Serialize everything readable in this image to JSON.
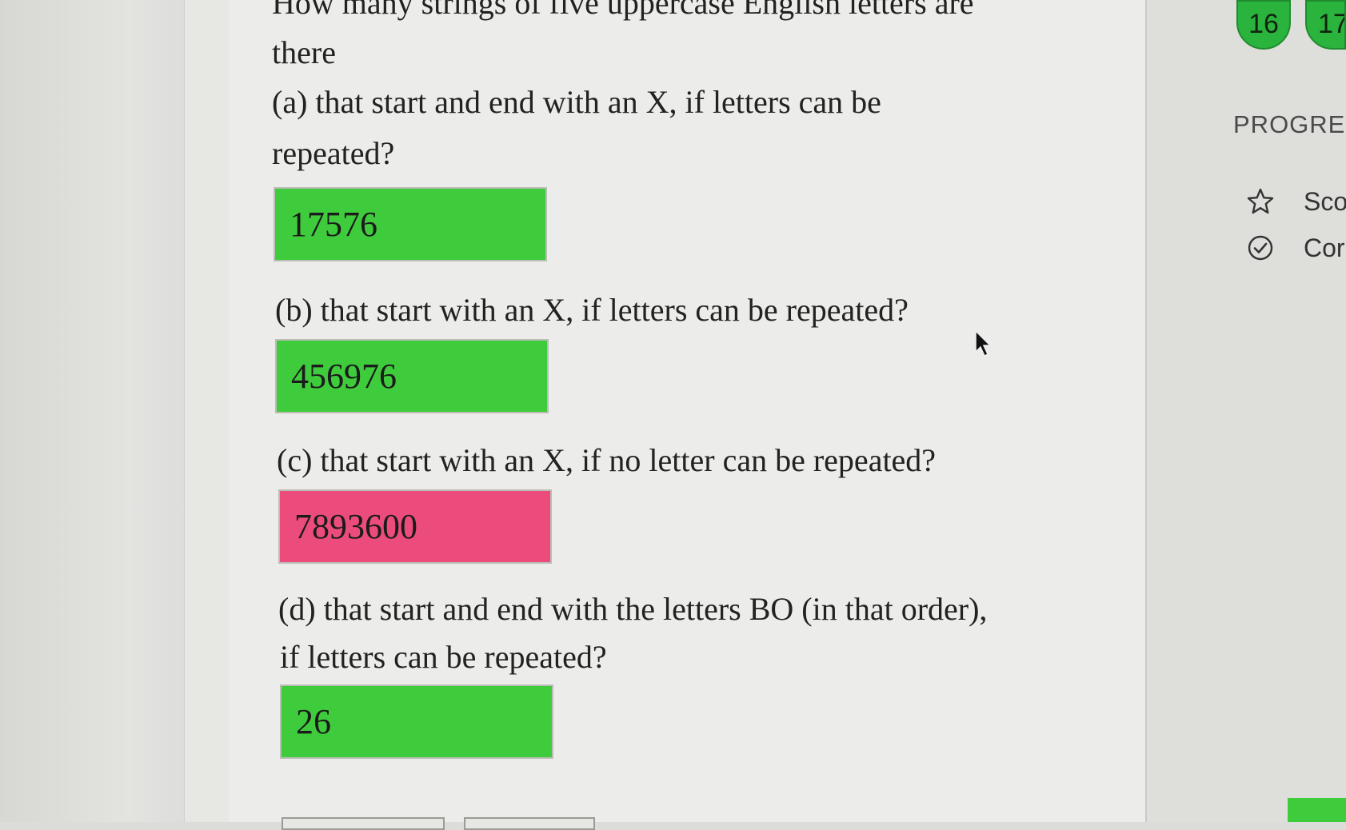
{
  "question": {
    "stem_line1": "How many strings of five uppercase English letters are",
    "stem_line2": "there",
    "parts": [
      {
        "label_line1": "(a) that start and end with an X, if letters can be",
        "label_line2": "repeated?",
        "answer": "17576",
        "status": "correct"
      },
      {
        "label_line1": "(b) that start with an X, if letters can be repeated?",
        "answer": "456976",
        "status": "correct"
      },
      {
        "label_line1": "(c) that start with an X, if no letter can be repeated?",
        "answer": "7893600",
        "status": "incorrect"
      },
      {
        "label_line1": "(d) that start and end with the letters BO (in that order),",
        "label_line2": "if letters can be repeated?",
        "answer": "26",
        "status": "correct"
      }
    ]
  },
  "sidebar": {
    "question_numbers": [
      "16",
      "17"
    ],
    "progress_heading": "PROGRES",
    "progress_items": [
      {
        "icon": "star-icon",
        "label": "Sco"
      },
      {
        "icon": "check-circle-icon",
        "label": "Cor"
      }
    ]
  },
  "colors": {
    "correct": "#3fcc3c",
    "incorrect": "#ec4c7b",
    "question_bubble": "#2bb43d"
  }
}
